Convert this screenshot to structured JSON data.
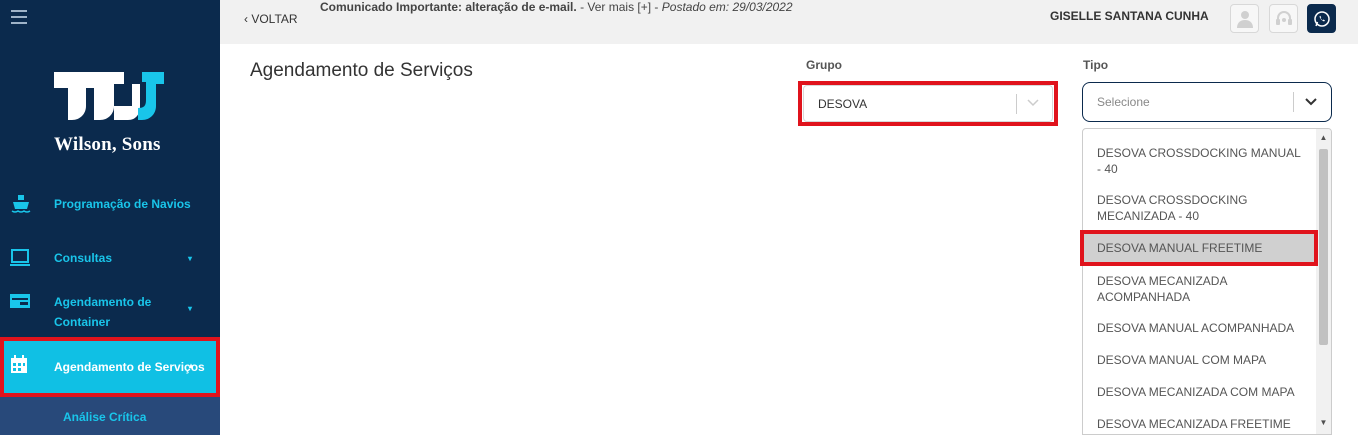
{
  "sidebar": {
    "brand": "Wilson, Sons",
    "items": [
      {
        "label": "Programação de Navios",
        "icon": "ship-icon"
      },
      {
        "label": "Consultas",
        "icon": "monitor-icon"
      },
      {
        "label": "Agendamento de",
        "label2": "Container",
        "icon": "container-icon"
      },
      {
        "label": "Agendamento de Serviços",
        "icon": "calendar-icon"
      }
    ],
    "subitems": [
      "Análise Crítica"
    ]
  },
  "topbar": {
    "back_label": "‹ VOLTAR",
    "notice_bold": "Comunicado Importante: alteração de e-mail.",
    "notice_more": " - Ver mais [+] - ",
    "notice_posted": "Postado em: 29/03/2022",
    "user_name": "GISELLE SANTANA CUNHA"
  },
  "main": {
    "title": "Agendamento de Serviços",
    "grupo": {
      "label": "Grupo",
      "value": "DESOVA"
    },
    "tipo": {
      "label": "Tipo",
      "placeholder": "Selecione",
      "options": [
        "DESOVA CROSSDOCKING MANUAL - 40",
        "DESOVA CROSSDOCKING MECANIZADA - 40",
        "DESOVA MANUAL FREETIME",
        "DESOVA MECANIZADA ACOMPANHADA",
        "DESOVA MANUAL ACOMPANHADA",
        "DESOVA MANUAL COM MAPA",
        "DESOVA MECANIZADA COM MAPA",
        "DESOVA MECANIZADA FREETIME"
      ],
      "highlighted_option": "DESOVA MANUAL FREETIME"
    }
  },
  "colors": {
    "sidebar_bg": "#0b2a4d",
    "accent": "#10c0e4",
    "highlight_outline": "#e0131c"
  }
}
